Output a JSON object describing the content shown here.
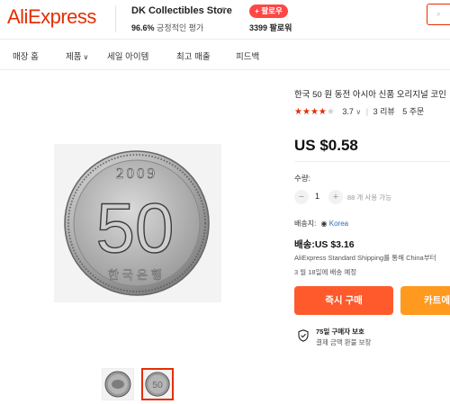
{
  "header": {
    "logo": "AliExpress",
    "store_name": "DK Collectibles Store",
    "store_rating_value": "96.6%",
    "store_rating_label": "긍정적인 평가",
    "follow_label": "+ 팔로우",
    "followers": "3399 팔로워"
  },
  "nav": {
    "items": [
      "매장 홈",
      "제품",
      "세일 아이템",
      "최고 매출",
      "피드백"
    ]
  },
  "gallery": {
    "coin_year": "2009",
    "coin_value": "50",
    "coin_text": "한국은행",
    "thumbnails": [
      "coin-obverse",
      "coin-reverse"
    ],
    "active_thumbnail_index": 1
  },
  "product": {
    "title": "한국 50 원 동전 아시아 신품 오리지널 코인",
    "star_rating": 4,
    "stars_total": 5,
    "rating": "3.7",
    "reviews": "3 리뷰",
    "orders": "5 주문",
    "price": "US $0.58"
  },
  "quantity": {
    "label": "수량:",
    "value": "1",
    "minus": "−",
    "plus": "+",
    "note": "88 개 사용 가능"
  },
  "shipping": {
    "ship_to_label": "배송지:",
    "ship_to": "Korea",
    "cost": "배송:US $3.16",
    "method": "AliExpress Standard Shipping를 통해 China부터",
    "delivery": "3 월 18일에 배송 예정"
  },
  "actions": {
    "buy_now": "즉시 구매",
    "add_to_cart": "카트에"
  },
  "protection": {
    "title": "75일 구매자 보호",
    "subtitle": "결제 금액 환불 보장"
  },
  "colors": {
    "brand": "#e62e04",
    "buy": "#ff5a2c",
    "cart": "#ff9a1f",
    "link": "#2a6ebb"
  }
}
